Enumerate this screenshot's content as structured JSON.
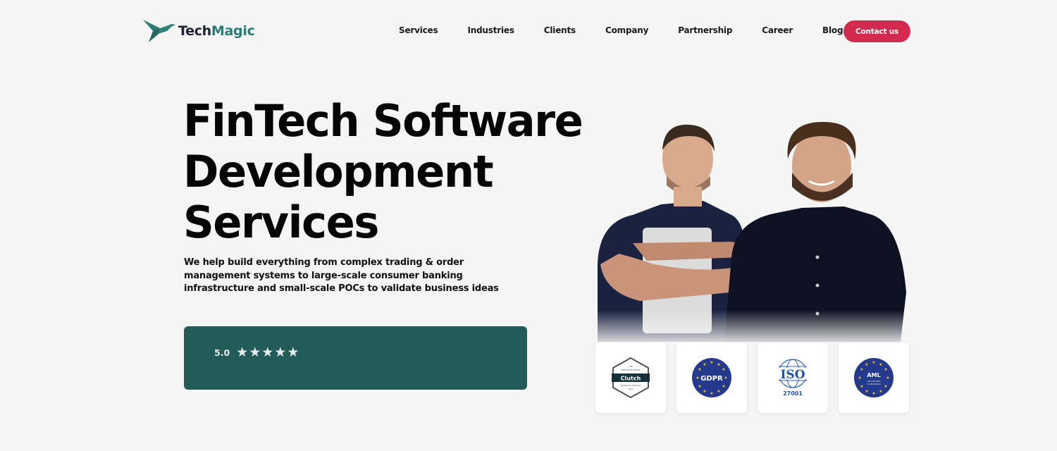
{
  "header": {
    "logo": {
      "part1": "Tech",
      "part2": "Magic",
      "brand_color": "#2c7a73"
    },
    "nav": [
      "Services",
      "Industries",
      "Clients",
      "Company",
      "Partnership",
      "Career",
      "Blog"
    ],
    "contact_label": "Contact us",
    "contact_color": "#d3294f"
  },
  "hero": {
    "title_lines": [
      "FinTech Software",
      "Development",
      "Services"
    ],
    "subtitle": "We help build everything from complex trading & order management systems to large-scale consumer banking infrastructure and small-scale POCs to validate business ideas",
    "rating": {
      "value": "5.0",
      "stars": 5,
      "card_color": "#235b58"
    }
  },
  "badges": [
    {
      "name": "clutch",
      "label": "Clutch",
      "top": "TOP WEB DEVELOPERS",
      "bottom": "FINANCIAL SERVICES 2023"
    },
    {
      "name": "gdpr",
      "label": "GDPR"
    },
    {
      "name": "iso",
      "label": "ISO",
      "sub": "27001"
    },
    {
      "name": "aml",
      "label": "AML",
      "sub": "ANTI-MONEY LAUNDERING"
    }
  ]
}
